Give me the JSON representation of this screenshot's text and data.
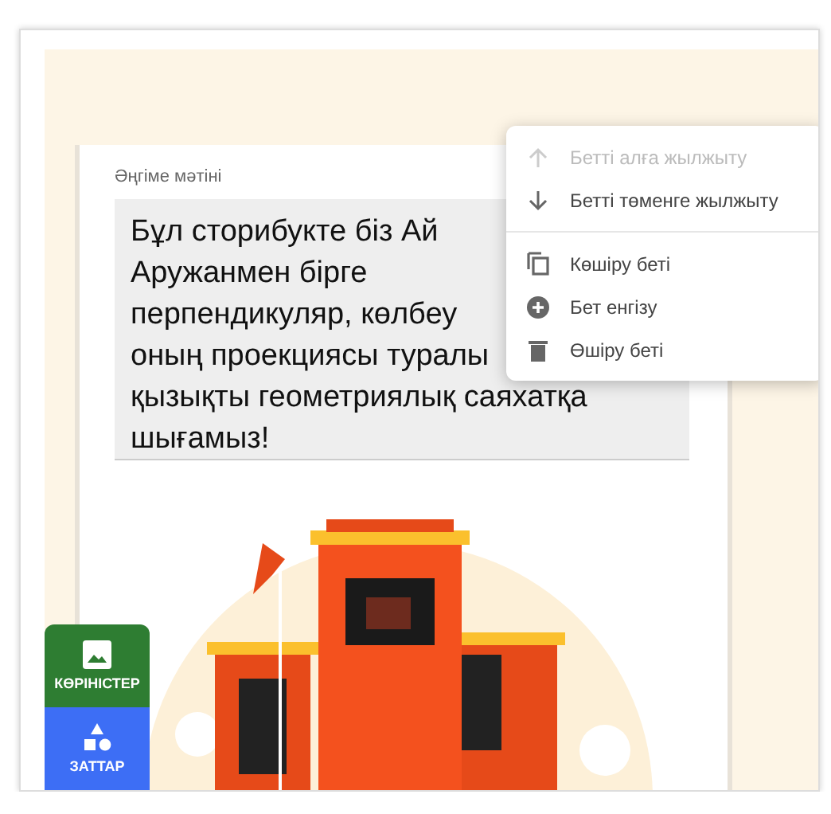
{
  "page_card": {
    "label": "Әңгіме мәтіні",
    "story_text": "Бұл сторибукте біз Ай\nАружанмен бірге\nперпендикуляр, көлбеу\nоның проекциясы туралы\nқызықты геометриялық саяхатқа\nшығамыз!"
  },
  "context_menu": [
    {
      "kind": "arrow-up",
      "label": "Бетті алға жылжыту",
      "disabled": true
    },
    {
      "kind": "arrow-down",
      "label": "Бетті төменге жылжыту",
      "disabled": false
    },
    {
      "kind": "divider"
    },
    {
      "kind": "copy",
      "label": "Көшіру беті",
      "disabled": false
    },
    {
      "kind": "add",
      "label": "Бет енгізу",
      "disabled": false
    },
    {
      "kind": "delete",
      "label": "Өшіру беті",
      "disabled": false
    }
  ],
  "side_tabs": [
    {
      "kind": "scenes",
      "label": "КӨРІНІСТЕР",
      "color": "#2e7d32"
    },
    {
      "kind": "objects",
      "label": "ЗАТТАР",
      "color": "#3d6ef5"
    }
  ]
}
